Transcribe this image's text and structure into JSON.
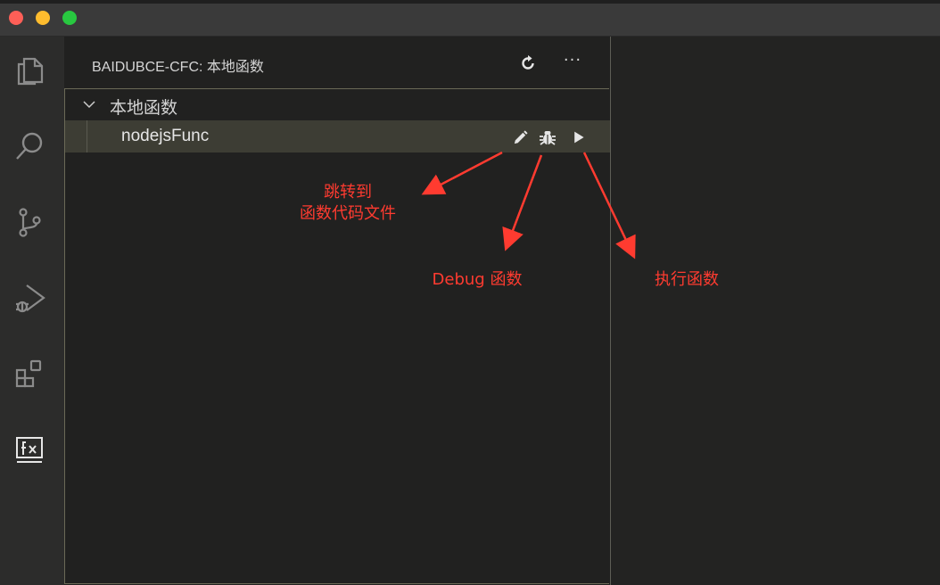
{
  "sidebar": {
    "title": "BAIDUBCE-CFC: 本地函数",
    "actions": {
      "refresh": "refresh-icon",
      "more": "···"
    }
  },
  "section": {
    "label": "本地函数",
    "items": [
      {
        "label": "nodejsFunc",
        "actions": [
          "edit-icon",
          "bug-icon",
          "play-icon"
        ]
      }
    ]
  },
  "activity_bar": [
    "explorer-icon",
    "search-icon",
    "source-control-icon",
    "run-debug-icon",
    "extensions-icon",
    "cfc-fx-icon"
  ],
  "annotations": {
    "edit": {
      "line1": "跳转到",
      "line2": "函数代码文件"
    },
    "debug": "Debug 函数",
    "run": "执行函数"
  },
  "colors": {
    "annotation": "#ff3b30",
    "selected_row": "#3d3d34",
    "traffic_red": "#fe5f57",
    "traffic_yellow": "#febc2e",
    "traffic_green": "#28c840"
  }
}
